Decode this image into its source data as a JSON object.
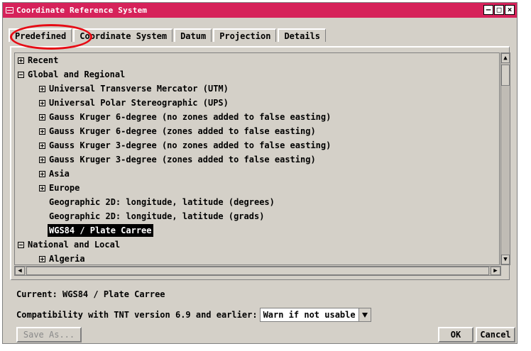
{
  "window": {
    "title": "Coordinate Reference System",
    "controls": [
      "–",
      "□",
      "×"
    ]
  },
  "tabs": [
    {
      "label": "Predefined",
      "active": true
    },
    {
      "label": "Coordinate System",
      "active": false
    },
    {
      "label": "Datum",
      "active": false
    },
    {
      "label": "Projection",
      "active": false
    },
    {
      "label": "Details",
      "active": false
    }
  ],
  "tree": {
    "items": [
      {
        "label": "Recent",
        "level": 0,
        "expander": "plus"
      },
      {
        "label": "Global and Regional",
        "level": 0,
        "expander": "minus"
      },
      {
        "label": "Universal Transverse Mercator (UTM)",
        "level": 1,
        "expander": "plus"
      },
      {
        "label": "Universal Polar Stereographic (UPS)",
        "level": 1,
        "expander": "plus"
      },
      {
        "label": "Gauss Kruger 6-degree (no zones added to false easting)",
        "level": 1,
        "expander": "plus"
      },
      {
        "label": "Gauss Kruger 6-degree (zones added to false easting)",
        "level": 1,
        "expander": "plus"
      },
      {
        "label": "Gauss Kruger 3-degree (no zones added to false easting)",
        "level": 1,
        "expander": "plus"
      },
      {
        "label": "Gauss Kruger 3-degree (zones added to false easting)",
        "level": 1,
        "expander": "plus"
      },
      {
        "label": "Asia",
        "level": 1,
        "expander": "plus"
      },
      {
        "label": "Europe",
        "level": 1,
        "expander": "plus"
      },
      {
        "label": "Geographic 2D: longitude, latitude (degrees)",
        "level": 1,
        "expander": "none"
      },
      {
        "label": "Geographic 2D: longitude, latitude (grads)",
        "level": 1,
        "expander": "none"
      },
      {
        "label": "WGS84 / Plate Carree",
        "level": 1,
        "expander": "none",
        "selected": true
      },
      {
        "label": "National and Local",
        "level": 0,
        "expander": "minus"
      },
      {
        "label": "Algeria",
        "level": 1,
        "expander": "plus"
      }
    ]
  },
  "status": {
    "current": "Current: WGS84 / Plate Carree"
  },
  "compat": {
    "label": "Compatibility with TNT version 6.9 and earlier:",
    "value": "Warn if not usable"
  },
  "buttons": {
    "save_as": "Save As...",
    "ok": "OK",
    "cancel": "Cancel"
  },
  "colors": {
    "titlebar": "#d6225a",
    "window_bg": "#d4d0c8",
    "highlight_circle": "#e60b14"
  }
}
